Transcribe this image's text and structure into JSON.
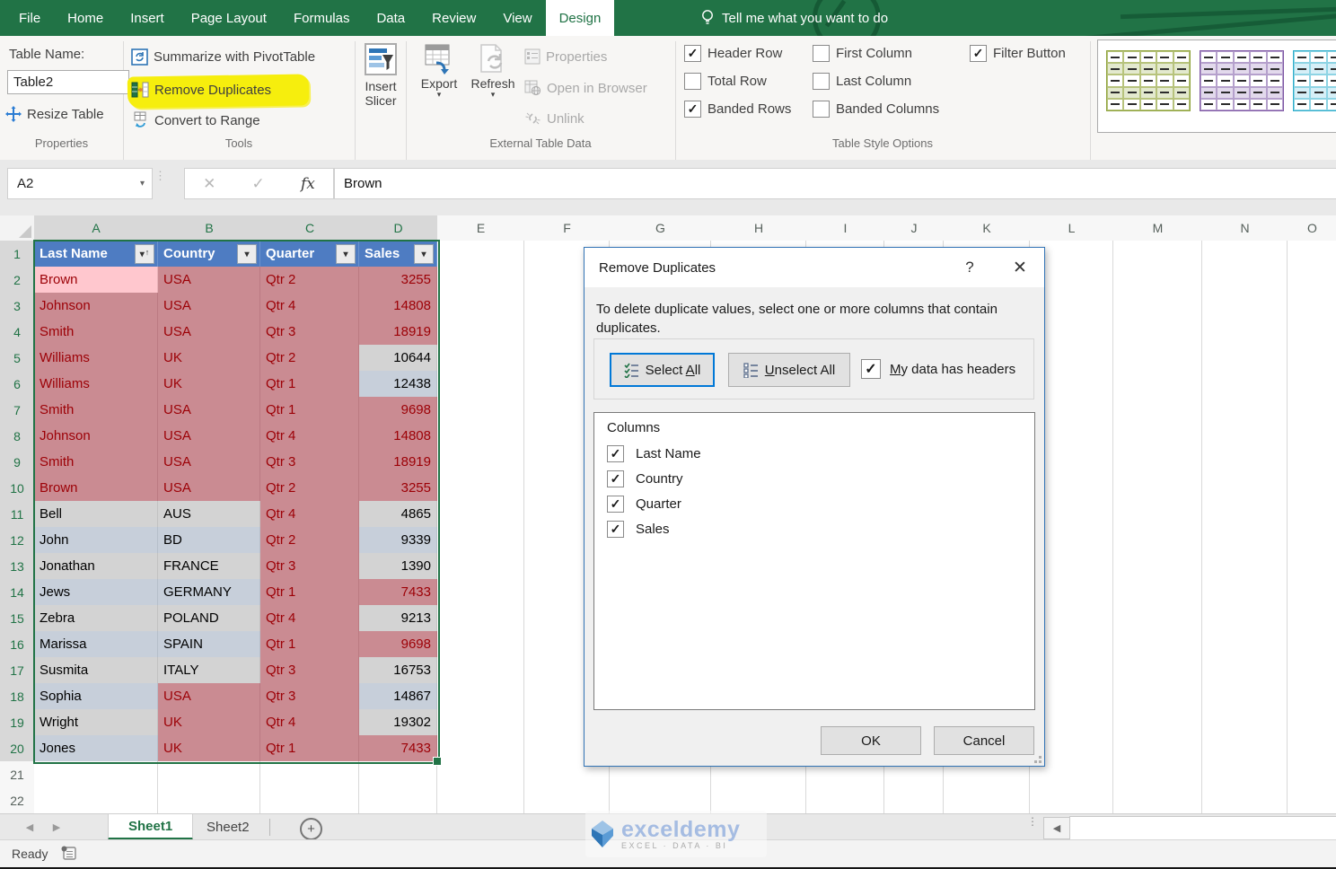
{
  "ribbon": {
    "tabs": [
      {
        "label": "File",
        "active": false
      },
      {
        "label": "Home",
        "active": false
      },
      {
        "label": "Insert",
        "active": false
      },
      {
        "label": "Page Layout",
        "active": false
      },
      {
        "label": "Formulas",
        "active": false
      },
      {
        "label": "Data",
        "active": false
      },
      {
        "label": "Review",
        "active": false
      },
      {
        "label": "View",
        "active": false
      },
      {
        "label": "Design",
        "active": true
      }
    ],
    "tell_me": "Tell me what you want to do",
    "groups": {
      "properties": {
        "caption": "Properties",
        "table_name_label": "Table Name:",
        "table_name_value": "Table2",
        "resize_table_label": "Resize Table"
      },
      "tools": {
        "caption": "Tools",
        "summarize_label": "Summarize with PivotTable",
        "remove_duplicates_label": "Remove Duplicates",
        "convert_label": "Convert to Range"
      },
      "slicer": {
        "line1": "Insert",
        "line2": "Slicer"
      },
      "external": {
        "caption": "External Table Data",
        "export_label": "Export",
        "refresh_label": "Refresh",
        "properties_label": "Properties",
        "open_in_browser_label": "Open in Browser",
        "unlink_label": "Unlink"
      },
      "style_options": {
        "caption": "Table Style Options",
        "col1": [
          {
            "label": "Header Row",
            "checked": true
          },
          {
            "label": "Total Row",
            "checked": false
          },
          {
            "label": "Banded Rows",
            "checked": true
          }
        ],
        "col2": [
          {
            "label": "First Column",
            "checked": false
          },
          {
            "label": "Last Column",
            "checked": false
          },
          {
            "label": "Banded Columns",
            "checked": false
          }
        ],
        "col3": [
          {
            "label": "Filter Button",
            "checked": true
          }
        ]
      },
      "styles_gallery": [
        {
          "name": "green-table-style",
          "border": "#8FA33C",
          "line": "#B7C37C",
          "band": "#E3E9CE"
        },
        {
          "name": "purple-table-style",
          "border": "#7E57A5",
          "line": "#B5A0CC",
          "band": "#E2D9EC"
        },
        {
          "name": "cyan-table-style",
          "border": "#2FAECB",
          "line": "#8ED4E4",
          "band": "#D6EFF7"
        }
      ]
    }
  },
  "formula_bar": {
    "name_box": "A2",
    "formula": "Brown"
  },
  "grid": {
    "column_letters": [
      "A",
      "B",
      "C",
      "D",
      "E",
      "F",
      "G",
      "H",
      "I",
      "J",
      "K",
      "L",
      "M",
      "N",
      "O"
    ],
    "selected_columns": [
      "A",
      "B",
      "C",
      "D"
    ],
    "table_headers": [
      "Last Name",
      "Country",
      "Quarter",
      "Sales"
    ],
    "rows": [
      {
        "n": 2,
        "cells": [
          [
            "Brown",
            "dupA"
          ],
          [
            "USA",
            "dup"
          ],
          [
            "Qtr 2",
            "dup"
          ],
          [
            "3255",
            "dup"
          ]
        ]
      },
      {
        "n": 3,
        "cells": [
          [
            "Johnson",
            "dup"
          ],
          [
            "USA",
            "dup"
          ],
          [
            "Qtr 4",
            "dup"
          ],
          [
            "14808",
            "dup"
          ]
        ]
      },
      {
        "n": 4,
        "cells": [
          [
            "Smith",
            "dup"
          ],
          [
            "USA",
            "dup"
          ],
          [
            "Qtr 3",
            "dup"
          ],
          [
            "18919",
            "dup"
          ]
        ]
      },
      {
        "n": 5,
        "cells": [
          [
            "Williams",
            "dup"
          ],
          [
            "UK",
            "dup"
          ],
          [
            "Qtr 2",
            "dup"
          ],
          [
            "10644",
            "b1"
          ]
        ]
      },
      {
        "n": 6,
        "cells": [
          [
            "Williams",
            "dup"
          ],
          [
            "UK",
            "dup"
          ],
          [
            "Qtr 1",
            "dup"
          ],
          [
            "12438",
            "b2"
          ]
        ]
      },
      {
        "n": 7,
        "cells": [
          [
            "Smith",
            "dup"
          ],
          [
            "USA",
            "dup"
          ],
          [
            "Qtr 1",
            "dup"
          ],
          [
            "9698",
            "dup"
          ]
        ]
      },
      {
        "n": 8,
        "cells": [
          [
            "Johnson",
            "dup"
          ],
          [
            "USA",
            "dup"
          ],
          [
            "Qtr 4",
            "dup"
          ],
          [
            "14808",
            "dup"
          ]
        ]
      },
      {
        "n": 9,
        "cells": [
          [
            "Smith",
            "dup"
          ],
          [
            "USA",
            "dup"
          ],
          [
            "Qtr 3",
            "dup"
          ],
          [
            "18919",
            "dup"
          ]
        ]
      },
      {
        "n": 10,
        "cells": [
          [
            "Brown",
            "dup"
          ],
          [
            "USA",
            "dup"
          ],
          [
            "Qtr 2",
            "dup"
          ],
          [
            "3255",
            "dup"
          ]
        ]
      },
      {
        "n": 11,
        "cells": [
          [
            "Bell",
            "b1"
          ],
          [
            "AUS",
            "b1"
          ],
          [
            "Qtr 4",
            "dup"
          ],
          [
            "4865",
            "b1"
          ]
        ]
      },
      {
        "n": 12,
        "cells": [
          [
            "John",
            "b2"
          ],
          [
            "BD",
            "b2"
          ],
          [
            "Qtr 2",
            "dup"
          ],
          [
            "9339",
            "b2"
          ]
        ]
      },
      {
        "n": 13,
        "cells": [
          [
            "Jonathan",
            "b1"
          ],
          [
            "FRANCE",
            "b1"
          ],
          [
            "Qtr 3",
            "dup"
          ],
          [
            "1390",
            "b1"
          ]
        ]
      },
      {
        "n": 14,
        "cells": [
          [
            "Jews",
            "b2"
          ],
          [
            "GERMANY",
            "b2"
          ],
          [
            "Qtr 1",
            "dup"
          ],
          [
            "7433",
            "dup"
          ]
        ]
      },
      {
        "n": 15,
        "cells": [
          [
            "Zebra",
            "b1"
          ],
          [
            "POLAND",
            "b1"
          ],
          [
            "Qtr 4",
            "dup"
          ],
          [
            "9213",
            "b1"
          ]
        ]
      },
      {
        "n": 16,
        "cells": [
          [
            "Marissa",
            "b2"
          ],
          [
            "SPAIN",
            "b2"
          ],
          [
            "Qtr 1",
            "dup"
          ],
          [
            "9698",
            "dup"
          ]
        ]
      },
      {
        "n": 17,
        "cells": [
          [
            "Susmita",
            "b1"
          ],
          [
            "ITALY",
            "b1"
          ],
          [
            "Qtr 3",
            "dup"
          ],
          [
            "16753",
            "b1"
          ]
        ]
      },
      {
        "n": 18,
        "cells": [
          [
            "Sophia",
            "b2"
          ],
          [
            "USA",
            "dup"
          ],
          [
            "Qtr 3",
            "dup"
          ],
          [
            "14867",
            "b2"
          ]
        ]
      },
      {
        "n": 19,
        "cells": [
          [
            "Wright",
            "b1"
          ],
          [
            "UK",
            "dup"
          ],
          [
            "Qtr 4",
            "dup"
          ],
          [
            "19302",
            "b1"
          ]
        ]
      },
      {
        "n": 20,
        "cells": [
          [
            "Jones",
            "b2"
          ],
          [
            "UK",
            "dup"
          ],
          [
            "Qtr 1",
            "dup"
          ],
          [
            "7433",
            "dup"
          ]
        ]
      }
    ],
    "empty_rows": [
      21,
      22
    ]
  },
  "dialog": {
    "title": "Remove Duplicates",
    "help_glyph": "?",
    "close_glyph": "✕",
    "instruction": "To delete duplicate values, select one or more columns that contain duplicates.",
    "select_all": {
      "pre": "Select ",
      "u": "A",
      "post": "ll"
    },
    "unselect_all": {
      "pre": "",
      "u": "U",
      "post": "nselect All"
    },
    "headers_checkbox": {
      "pre": "",
      "u": "M",
      "post": "y data has headers",
      "checked": true
    },
    "columns_label": "Columns",
    "columns": [
      {
        "label": "Last Name",
        "checked": true
      },
      {
        "label": "Country",
        "checked": true
      },
      {
        "label": "Quarter",
        "checked": true
      },
      {
        "label": "Sales",
        "checked": true
      }
    ],
    "ok_label": "OK",
    "cancel_label": "Cancel"
  },
  "sheet_bar": {
    "tabs": [
      {
        "label": "Sheet1",
        "active": true
      },
      {
        "label": "Sheet2",
        "active": false
      }
    ],
    "new_sheet_glyph": "+"
  },
  "status_bar": {
    "ready": "Ready"
  },
  "watermark": {
    "brand": "exceldemy",
    "tagline": "EXCEL · DATA · BI"
  },
  "colors": {
    "excel_green": "#217346",
    "table_header_blue": "#4E7CC2",
    "duplicate_fill": "#CA8B92",
    "duplicate_text": "#9C0006",
    "active_cell_fill": "#FFC7CE",
    "band_gray": "#D3D3D3",
    "band_blue": "#C7CFDA",
    "highlight_yellow": "#F6EE0D",
    "dialog_border": "#3173B5",
    "focus_blue": "#0078D7"
  },
  "icons": {
    "tell_me": "lightbulb-icon",
    "summarize": "pivottable-icon",
    "remove_duplicates": "remove-duplicates-icon",
    "convert": "convert-to-range-icon",
    "resize": "resize-table-icon",
    "slicer": "slicer-icon",
    "export": "export-icon",
    "refresh": "refresh-icon",
    "select_all": "checklist-icon",
    "unselect_all": "unchecked-list-icon"
  }
}
